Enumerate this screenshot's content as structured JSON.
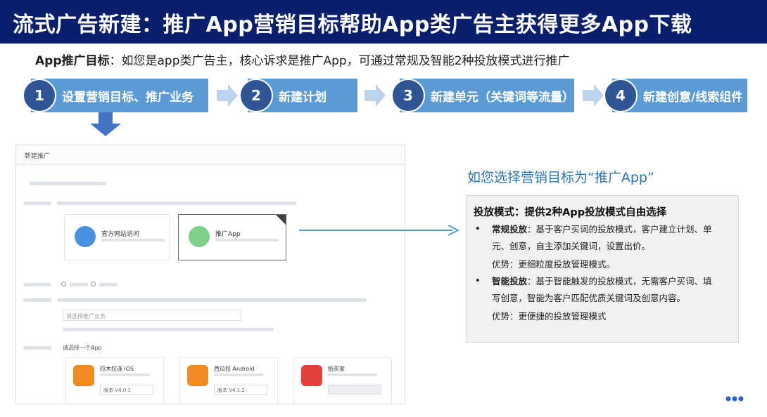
{
  "header": {
    "title": "流式广告新建：推广App营销目标帮助App类广告主获得更多App下载"
  },
  "subtitle": {
    "label": "App推广目标",
    "text": "：如您是app类广告主，核心诉求是推广App，可通过常规及智能2种投放模式进行推广"
  },
  "steps": [
    {
      "num": "1",
      "label": "设置营销目标、推广业务"
    },
    {
      "num": "2",
      "label": "新建计划"
    },
    {
      "num": "3",
      "label": "新建单元（关键词等流量）"
    },
    {
      "num": "4",
      "label": "新建创意/线索组件"
    }
  ],
  "mock": {
    "window_title": "新建推广",
    "card_web": "官方网站访问",
    "card_app": "推广App",
    "select_placeholder": "请选择推广业务",
    "app_prompt": "请选择一个App",
    "apps": [
      {
        "name": "拉木拉连 iOS",
        "select": "版本 V4.0.1"
      },
      {
        "name": "西瓜拉 Android",
        "select": "版本 V4.1.2"
      },
      {
        "name": "拍买家",
        "select": ""
      }
    ],
    "icon_colors": {
      "web": "#4a90e2",
      "app": "#7ed08a",
      "app1": "#f08a24",
      "app2": "#f08a24",
      "app3": "#e0413a"
    }
  },
  "side": {
    "title": "如您选择营销目标为“推广App”"
  },
  "box": {
    "heading": "投放模式：提供2种App投放模式自由选择",
    "b1_key": "常规投放",
    "b1_line1": "：基于客户买词的投放模式，客户建立计划、单",
    "b1_line2": "元、创意，自主添加关键词，设置出价。",
    "b1_adv": "优势：更细粒度投放管理模式。",
    "b2_key": "智能投放",
    "b2_line1": "：基于智能触发的投放模式，无需客户买词、填",
    "b2_line2": "写创意，智能为客户匹配优质关键词及创意内容。",
    "b2_adv": "优势：更便捷的投放管理模式"
  },
  "colors": {
    "header_bg": "#0a1f6b",
    "step_bg": "#5b9bd5",
    "step_circle": "#2f5597",
    "accent_blue": "#2e75b6"
  }
}
